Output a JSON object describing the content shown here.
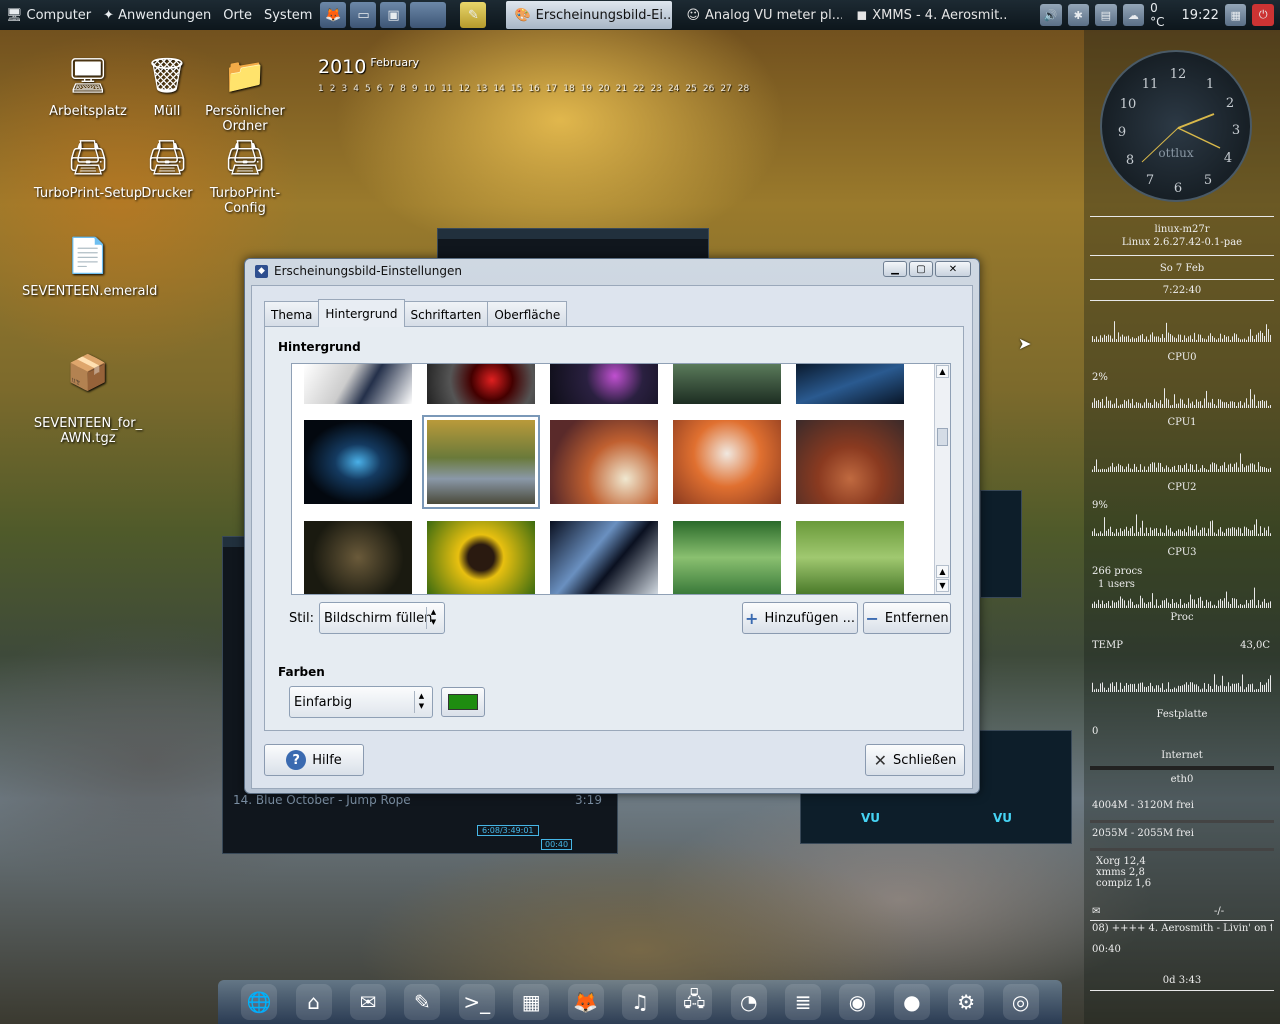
{
  "panel": {
    "menu": [
      "Computer",
      "Anwendungen",
      "Orte",
      "System"
    ],
    "tasks": [
      {
        "label": "Erscheinungsbild-Ei...",
        "active": true
      },
      {
        "label": "Analog VU meter pl...",
        "active": false
      },
      {
        "label": "XMMS - 4. Aerosmit...",
        "active": false
      }
    ],
    "tray": {
      "temperature": "0 °C",
      "time": "19:22"
    }
  },
  "desktop_icons": [
    {
      "label": "Arbeitsplatz",
      "icon": "computer-icon"
    },
    {
      "label": "Müll",
      "icon": "trash-icon"
    },
    {
      "label": "Persönlicher Ordner",
      "icon": "home-folder-icon"
    },
    {
      "label": "TurboPrint-Setup",
      "icon": "printer-icon"
    },
    {
      "label": "Drucker",
      "icon": "printer-icon"
    },
    {
      "label": "TurboPrint-Config",
      "icon": "printer-icon"
    },
    {
      "label": "SEVENTEEN.emerald",
      "icon": "document-icon"
    },
    {
      "label": "SEVENTEEN_for_\nAWN.tgz",
      "icon": "archive-icon"
    }
  ],
  "calendar": {
    "year": "2010",
    "month": "February",
    "days": [
      "1",
      "2",
      "3",
      "4",
      "5",
      "6",
      "7",
      "8",
      "9",
      "10",
      "11",
      "12",
      "13",
      "14",
      "15",
      "16",
      "17",
      "18",
      "19",
      "20",
      "21",
      "22",
      "23",
      "24",
      "25",
      "26",
      "27",
      "28"
    ]
  },
  "xmms": {
    "playlist_item": "14. Blue October - Jump Rope",
    "playlist_time": "3:19",
    "position": "6:08/3:49:01",
    "elapsed": "00:40"
  },
  "dialog": {
    "title": "Erscheinungsbild-Einstellungen",
    "tabs": [
      "Thema",
      "Hintergrund",
      "Schriftarten",
      "Oberfläche"
    ],
    "active_tab": "Hintergrund",
    "background_heading": "Hintergrund",
    "style_label": "Stil:",
    "style_value": "Bildschirm füllen",
    "add_button": "Hinzufügen ...",
    "remove_button": "Entfernen",
    "colors_heading": "Farben",
    "color_mode": "Einfarbig",
    "color_value": "#1e8c10",
    "help_button": "Hilfe",
    "close_button": "Schließen"
  },
  "conky": {
    "clock_label": "ottlux",
    "hostname": "linux-m27r",
    "kernel": "Linux 2.6.27.42-0.1-pae",
    "date": "So  7 Feb",
    "uptime": "7:22:40",
    "cpu_labels": [
      "CPU0",
      "CPU1",
      "CPU2",
      "CPU3"
    ],
    "cpu1_pct": "2%",
    "cpu3_pct": "9%",
    "procs": "266 procs",
    "users": "1 users",
    "proc_label": "Proc",
    "temp_label": "TEMP",
    "temp_value": "43,0C",
    "disk_label": "Festplatte",
    "disk_zero": "0",
    "internet_label": "Internet",
    "iface": "eth0",
    "mem": "4004M - 3120M frei",
    "swap": "2055M - 2055M frei",
    "top_procs": [
      {
        "name": "Xorg",
        "val": "12,4"
      },
      {
        "name": "xmms",
        "val": "2,8"
      },
      {
        "name": "compiz",
        "val": "1,6"
      }
    ],
    "mail_marker": "-/-",
    "now_playing": "08) ++++ 4. Aerosmith - Livin' on the",
    "play_time": "00:40",
    "play_remaining": "0d 3:43"
  },
  "dock": [
    "globe-icon",
    "home-icon",
    "mail-icon",
    "notes-icon",
    "terminal-icon",
    "calendar-icon",
    "firefox-icon",
    "music-icon",
    "network-icon",
    "office-icon",
    "writer-icon",
    "gimp-icon",
    "kiwi-icon",
    "settings-icon",
    "audio-cd-icon"
  ]
}
